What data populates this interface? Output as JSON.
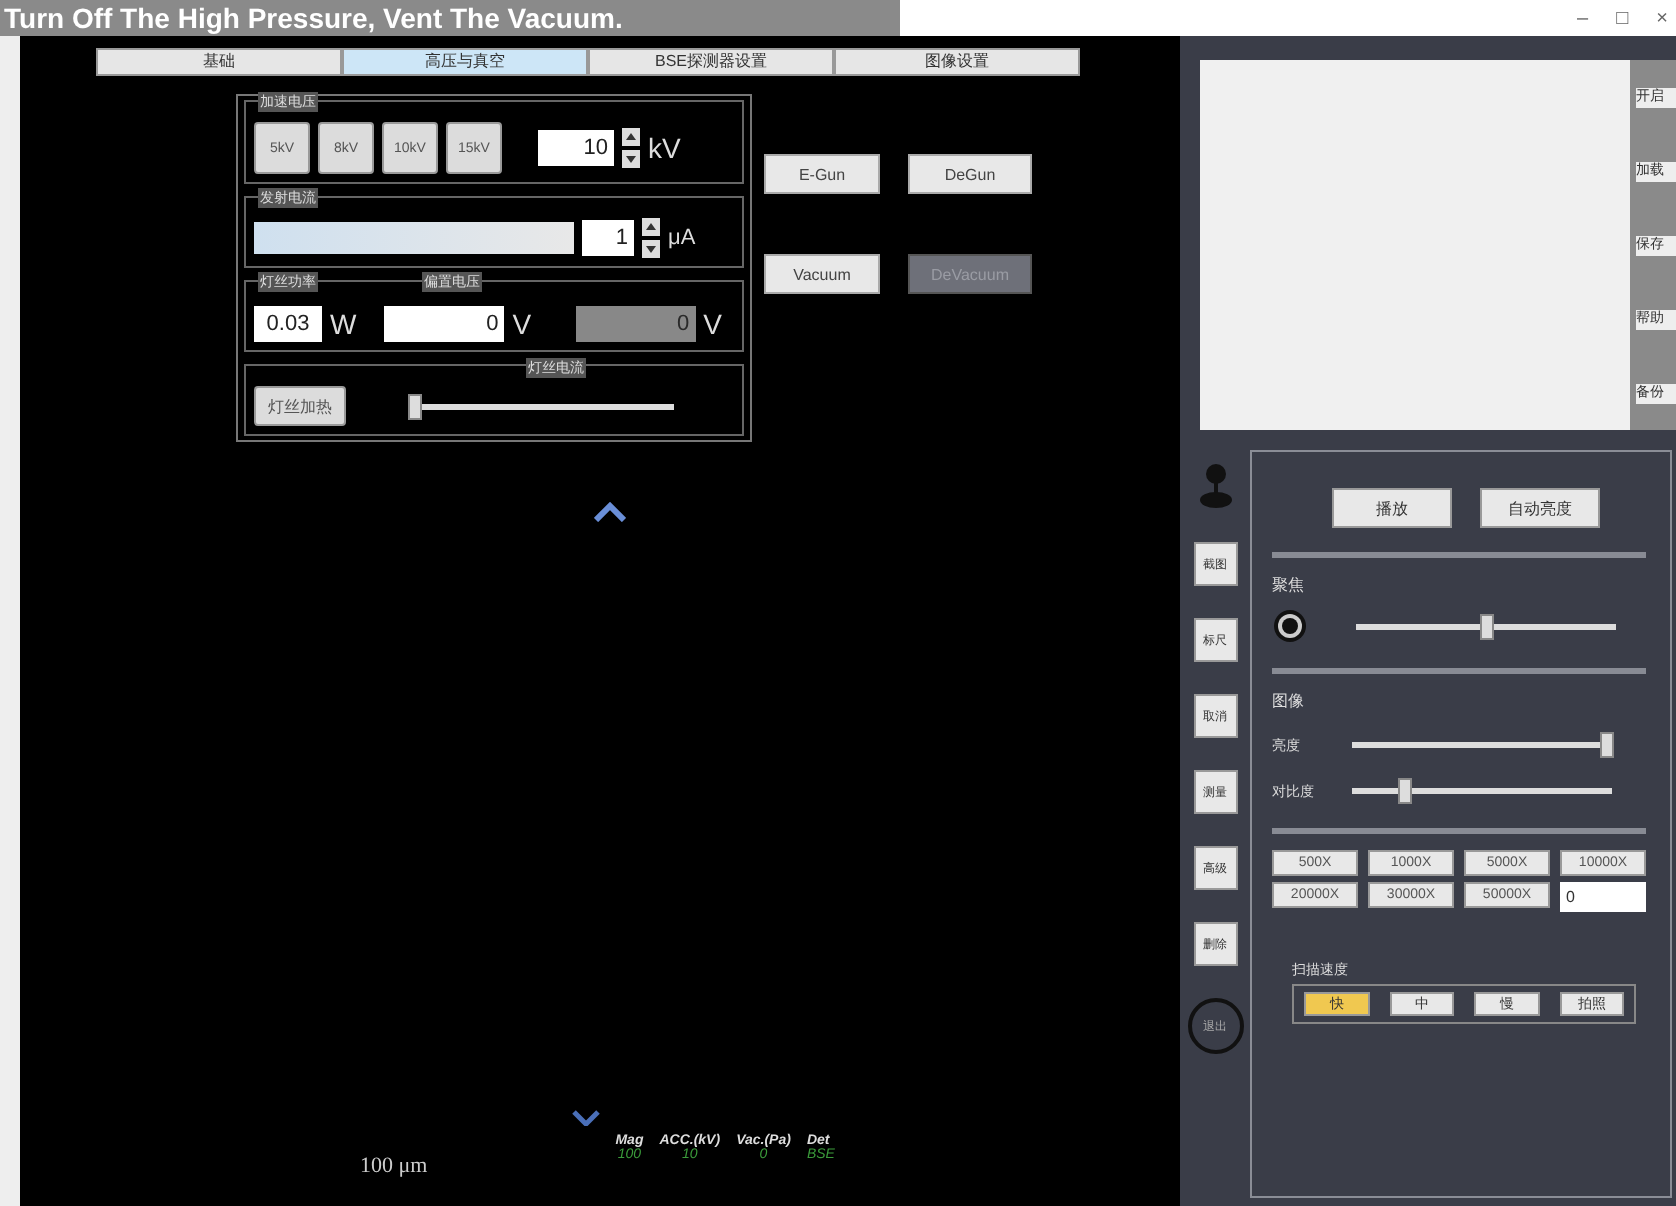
{
  "caption": "Turn Off The High Pressure, Vent The Vacuum.",
  "window_controls": [
    "–",
    "□",
    "×"
  ],
  "tabs": [
    {
      "label": "基础",
      "selected": false
    },
    {
      "label": "高压与真空",
      "selected": true
    },
    {
      "label": "BSE探测器设置",
      "selected": false
    },
    {
      "label": "图像设置",
      "selected": false
    }
  ],
  "hv_panel": {
    "accel_voltage": {
      "label": "加速电压",
      "presets": [
        "5kV",
        "8kV",
        "10kV",
        "15kV"
      ],
      "value": "10",
      "unit": "kV"
    },
    "emission": {
      "label": "发射电流",
      "value": "1",
      "unit": "μA"
    },
    "filament_power": {
      "label": "灯丝功率",
      "value": "0.03",
      "unit": "W"
    },
    "bias_voltage": {
      "label": "偏置电压",
      "value": "0",
      "unit": "V",
      "readout": "0",
      "readout_unit": "V"
    },
    "filament": {
      "label": "灯丝电流",
      "button": "灯丝加热",
      "level": 0.0
    }
  },
  "action_buttons": [
    {
      "label": "E-Gun",
      "disabled": false
    },
    {
      "label": "DeGun",
      "disabled": false
    },
    {
      "label": "Vacuum",
      "disabled": false
    },
    {
      "label": "DeVacuum",
      "disabled": true
    }
  ],
  "viewer": {
    "scale_label": "100 μm",
    "status_headers": [
      "Mag",
      "ACC.(kV)",
      "Vac.(Pa)",
      "Det"
    ],
    "status_values": [
      "100",
      "10",
      "0",
      "BSE"
    ]
  },
  "preview_tabs": [
    "开启",
    "加载",
    "保存",
    "帮助",
    "备份"
  ],
  "side_buttons": [
    "截图",
    "标尺",
    "取消",
    "测量",
    "高级",
    "删除"
  ],
  "exit_button": "退出",
  "top_buttons": [
    "播放",
    "自动亮度"
  ],
  "focus": {
    "label": "聚焦",
    "level": 0.5
  },
  "image": {
    "label": "图像",
    "sliders": [
      {
        "label": "亮度",
        "level": 0.98
      },
      {
        "label": "对比度",
        "level": 0.2
      }
    ]
  },
  "magnifications": [
    "500X",
    "1000X",
    "5000X",
    "10000X",
    "20000X",
    "30000X",
    "50000X"
  ],
  "magnification_input": "0",
  "scan_speed": {
    "label": "扫描速度",
    "options": [
      {
        "label": "快",
        "selected": true
      },
      {
        "label": "中",
        "selected": false
      },
      {
        "label": "慢",
        "selected": false
      },
      {
        "label": "拍照",
        "selected": false
      }
    ]
  }
}
